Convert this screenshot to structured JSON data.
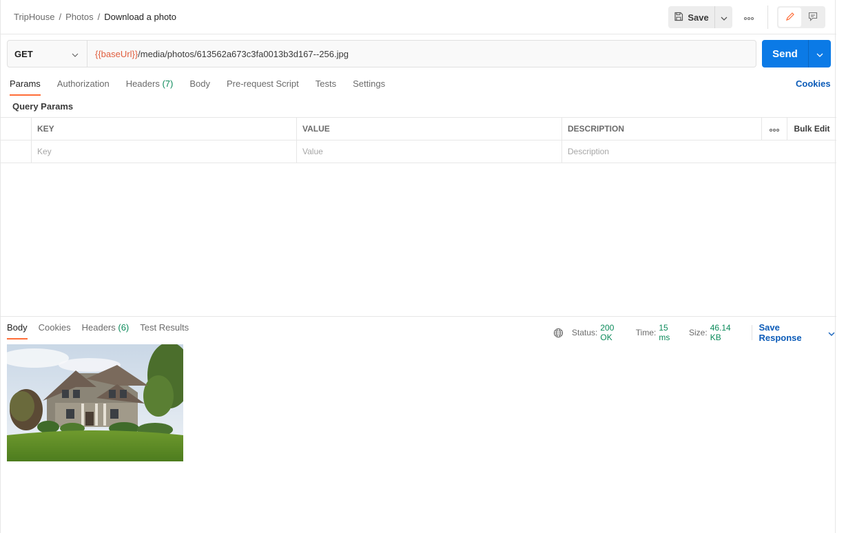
{
  "breadcrumb": {
    "items": [
      "TripHouse",
      "Photos"
    ],
    "separator": "/",
    "current": "Download a photo"
  },
  "toolbar": {
    "save_label": "Save"
  },
  "request": {
    "method": "GET",
    "url_variable": "{{baseUrl}}",
    "url_path": "/media/photos/613562a673c3fa0013b3d167--256.jpg",
    "send_label": "Send"
  },
  "request_tabs": [
    {
      "label": "Params",
      "count": ""
    },
    {
      "label": "Authorization",
      "count": ""
    },
    {
      "label": "Headers",
      "count": "(7)"
    },
    {
      "label": "Body",
      "count": ""
    },
    {
      "label": "Pre-request Script",
      "count": ""
    },
    {
      "label": "Tests",
      "count": ""
    },
    {
      "label": "Settings",
      "count": ""
    }
  ],
  "cookies_link": "Cookies",
  "query_params": {
    "title": "Query Params",
    "headers": {
      "key": "KEY",
      "value": "VALUE",
      "description": "DESCRIPTION",
      "bulk_edit": "Bulk Edit"
    },
    "placeholders": {
      "key": "Key",
      "value": "Value",
      "description": "Description"
    }
  },
  "response_tabs": [
    {
      "label": "Body",
      "count": ""
    },
    {
      "label": "Cookies",
      "count": ""
    },
    {
      "label": "Headers",
      "count": "(6)"
    },
    {
      "label": "Test Results",
      "count": ""
    }
  ],
  "response_status": {
    "status_label": "Status:",
    "status_value": "200 OK",
    "time_label": "Time:",
    "time_value": "15 ms",
    "size_label": "Size:",
    "size_value": "46.14 KB",
    "save_response": "Save Response"
  },
  "colors": {
    "accent": "#ff6c37",
    "primary": "#0b7ae6",
    "success": "#0b8a5a",
    "variable": "#e05d3d",
    "link": "#0b5bb8"
  }
}
